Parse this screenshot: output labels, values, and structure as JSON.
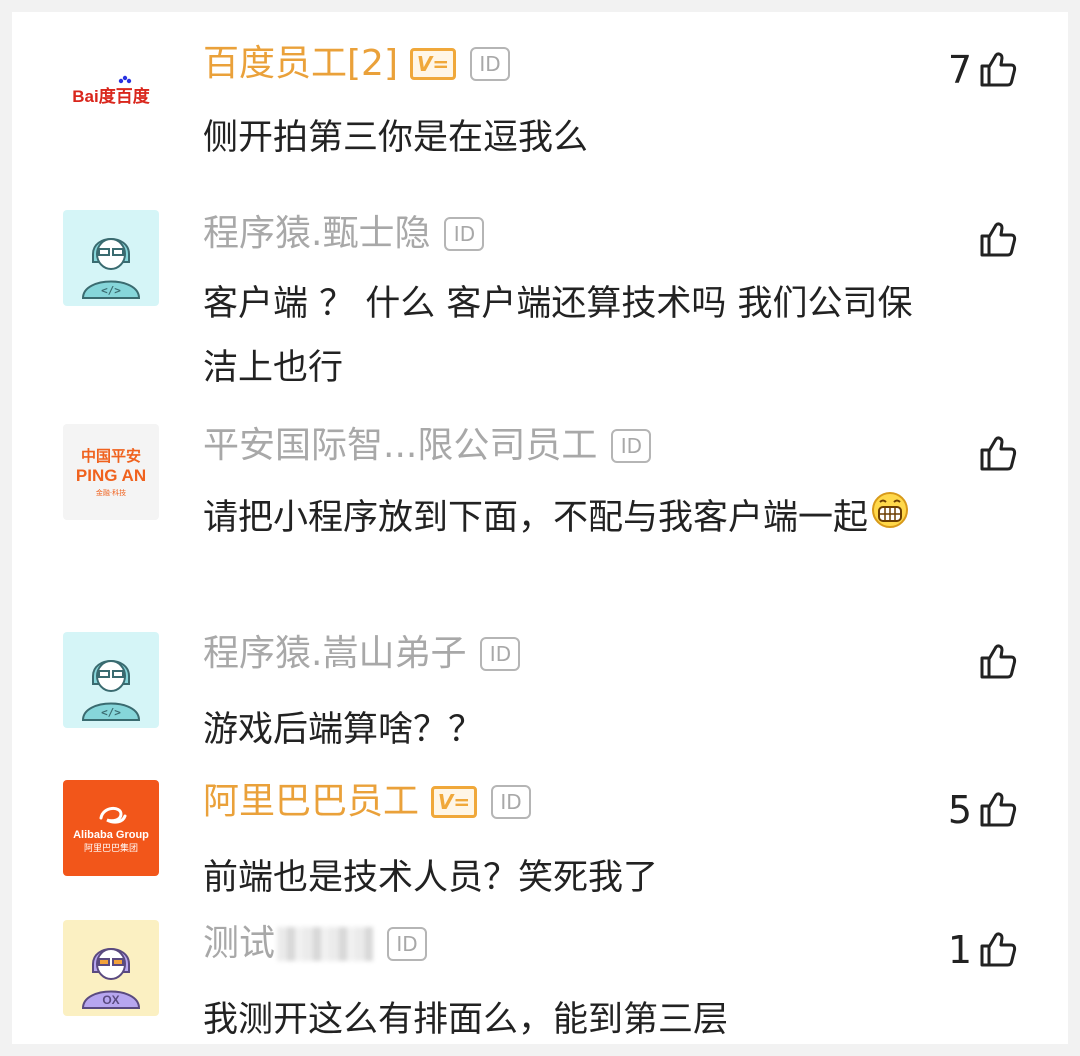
{
  "comments": [
    {
      "avatar": "baidu-logo",
      "username": "百度员工[2]",
      "verified": "V=",
      "id_badge": "ID",
      "text": "侧开拍第三你是在逗我么",
      "likes": "7",
      "avatar_text": "Bai度百度"
    },
    {
      "avatar": "programmer-avatar",
      "username": "程序猿.甄士隐",
      "id_badge": "ID",
      "text": "客户端 ？ 什么 客户端还算技术吗 我们公司保洁上也行",
      "likes": "",
      "avatar_text": "</>"
    },
    {
      "avatar": "pingan-logo",
      "username": "平安国际智...限公司员工",
      "id_badge": "ID",
      "text": "请把小程序放到下面，不配与我客户端一起",
      "likes": "",
      "avatar_text_1": "中国平安",
      "avatar_text_2": "PING AN",
      "avatar_text_3": "金融·科技"
    },
    {
      "avatar": "programmer-avatar",
      "username": "程序猿.嵩山弟子",
      "id_badge": "ID",
      "text": "游戏后端算啥？？",
      "likes": "",
      "avatar_text": "</>"
    },
    {
      "avatar": "alibaba-logo",
      "username": "阿里巴巴员工",
      "verified": "V=",
      "id_badge": "ID",
      "text": "前端也是技术人员？笑死我了",
      "likes": "5",
      "avatar_text_1": "Alibaba Group",
      "avatar_text_2": "阿里巴巴集团"
    },
    {
      "avatar": "tester-avatar",
      "username": "测试",
      "id_badge": "ID",
      "text": "我测开这么有排面么，能到第三层",
      "likes": "1",
      "avatar_text": "OX"
    }
  ],
  "colors": {
    "gold_name": "#eaa13a",
    "grey_name": "#a8a8a8",
    "text": "#222222",
    "alibaba_orange": "#f2561a",
    "pingan_orange": "#f0621e",
    "programmer_bg": "#d5f5f7",
    "tester_bg": "#fbf0c2"
  }
}
